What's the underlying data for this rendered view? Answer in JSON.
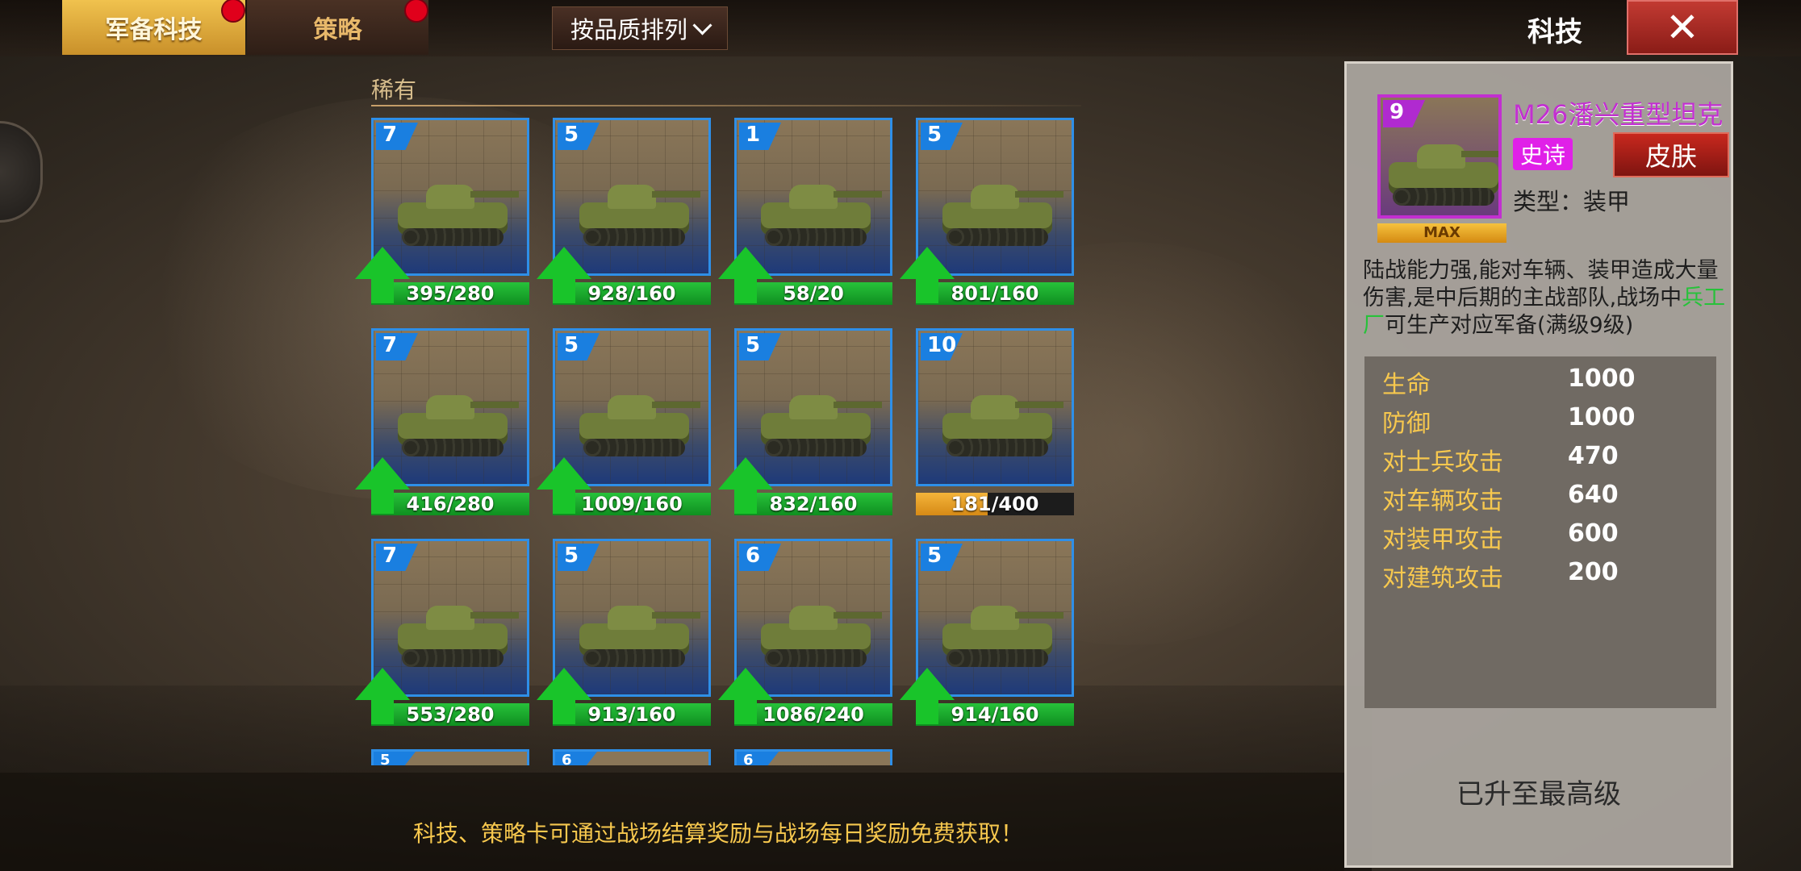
{
  "tabs": [
    {
      "label": "军备科技",
      "active": true,
      "has_notification": true
    },
    {
      "label": "策略",
      "active": false,
      "has_notification": true
    }
  ],
  "sort_label": "按品质排列",
  "screen_title": "科技",
  "close_icon": "close-icon",
  "section_label": "稀有",
  "cards": [
    {
      "level": "7",
      "unit": "rifle-helmet",
      "progress": "395/280",
      "fill": 1.0,
      "upgradable": true
    },
    {
      "level": "5",
      "unit": "anti-tank-gun",
      "progress": "928/160",
      "fill": 1.0,
      "upgradable": true
    },
    {
      "level": "1",
      "unit": "tow-truck",
      "progress": "58/20",
      "fill": 1.0,
      "upgradable": true
    },
    {
      "level": "5",
      "unit": "jeep",
      "progress": "801/160",
      "fill": 1.0,
      "upgradable": true
    },
    {
      "level": "7",
      "unit": "light-tank",
      "progress": "416/280",
      "fill": 1.0,
      "upgradable": true
    },
    {
      "level": "5",
      "unit": "motorcycle",
      "progress": "1009/160",
      "fill": 1.0,
      "upgradable": true
    },
    {
      "level": "5",
      "unit": "armored-car",
      "progress": "832/160",
      "fill": 1.0,
      "upgradable": true
    },
    {
      "level": "10",
      "unit": "self-propelled-gun",
      "progress": "181/400",
      "fill": 0.4525,
      "upgradable": false
    },
    {
      "level": "7",
      "unit": "medium-tank",
      "progress": "553/280",
      "fill": 1.0,
      "upgradable": true
    },
    {
      "level": "5",
      "unit": "anti-aircraft-gun",
      "progress": "913/160",
      "fill": 1.0,
      "upgradable": true
    },
    {
      "level": "6",
      "unit": "howitzer",
      "progress": "1086/240",
      "fill": 1.0,
      "upgradable": true
    },
    {
      "level": "5",
      "unit": "tank-destroyer",
      "progress": "914/160",
      "fill": 1.0,
      "upgradable": true
    }
  ],
  "partial_cards": [
    "5",
    "6",
    "6"
  ],
  "tip": "科技、策略卡可通过战场结算奖励与战场每日奖励免费获取！",
  "detail": {
    "level": "9",
    "max_label": "MAX",
    "name": "M26潘兴重型坦克",
    "rarity": "史诗",
    "skin_button": "皮肤",
    "type": "类型：装甲",
    "desc_1": "陆战能力强,能对车辆、装甲造成大量伤害,是中后期的主战部队,战场中",
    "desc_hl": "兵工厂",
    "desc_2": "可生产对应军备(满级9级)",
    "stats": [
      {
        "label": "生命",
        "value": "1000"
      },
      {
        "label": "防御",
        "value": "1000"
      },
      {
        "label": "对士兵攻击",
        "value": "470"
      },
      {
        "label": "对车辆攻击",
        "value": "640"
      },
      {
        "label": "对装甲攻击",
        "value": "600"
      },
      {
        "label": "对建筑攻击",
        "value": "200"
      }
    ],
    "status": "已升至最高级"
  }
}
